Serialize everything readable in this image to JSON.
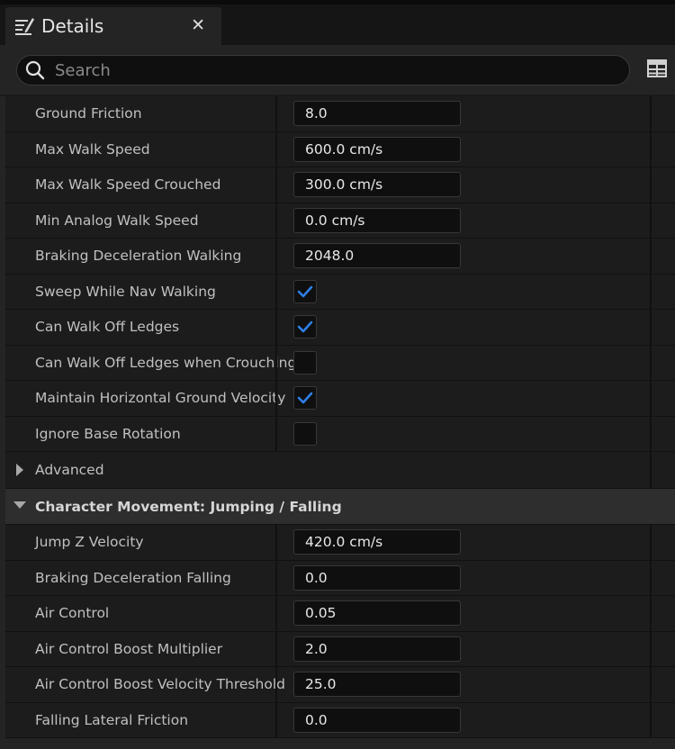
{
  "tab": {
    "title": "Details",
    "close": "✕",
    "icon": "edit-icon"
  },
  "search": {
    "placeholder": "Search",
    "value": ""
  },
  "toolbar": {
    "grid_icon": "table-view-icon"
  },
  "rows_walking": [
    {
      "label": "Ground Friction",
      "type": "field",
      "value": "8.0"
    },
    {
      "label": "Max Walk Speed",
      "type": "field",
      "value": "600.0 cm/s"
    },
    {
      "label": "Max Walk Speed Crouched",
      "type": "field",
      "value": "300.0 cm/s"
    },
    {
      "label": "Min Analog Walk Speed",
      "type": "field",
      "value": "0.0 cm/s"
    },
    {
      "label": "Braking Deceleration Walking",
      "type": "field",
      "value": "2048.0"
    },
    {
      "label": "Sweep While Nav Walking",
      "type": "check",
      "checked": true
    },
    {
      "label": "Can Walk Off Ledges",
      "type": "check",
      "checked": true
    },
    {
      "label": "Can Walk Off Ledges when Crouching",
      "type": "check",
      "checked": false
    },
    {
      "label": "Maintain Horizontal Ground Velocity",
      "type": "check",
      "checked": true
    },
    {
      "label": "Ignore Base Rotation",
      "type": "check",
      "checked": false
    }
  ],
  "advanced": {
    "label": "Advanced",
    "expanded": false
  },
  "section_jumping": {
    "title": "Character Movement: Jumping / Falling",
    "expanded": true
  },
  "rows_jumping": [
    {
      "label": "Jump Z Velocity",
      "value": "420.0 cm/s"
    },
    {
      "label": "Braking Deceleration Falling",
      "value": "0.0"
    },
    {
      "label": "Air Control",
      "value": "0.05"
    },
    {
      "label": "Air Control Boost Multiplier",
      "value": "2.0"
    },
    {
      "label": "Air Control Boost Velocity Threshold",
      "value": "25.0"
    },
    {
      "label": "Falling Lateral Friction",
      "value": "0.0"
    }
  ],
  "colors": {
    "check": "#2f7fe8",
    "field_bg": "#0f0f0f",
    "panel_bg": "#242424"
  }
}
